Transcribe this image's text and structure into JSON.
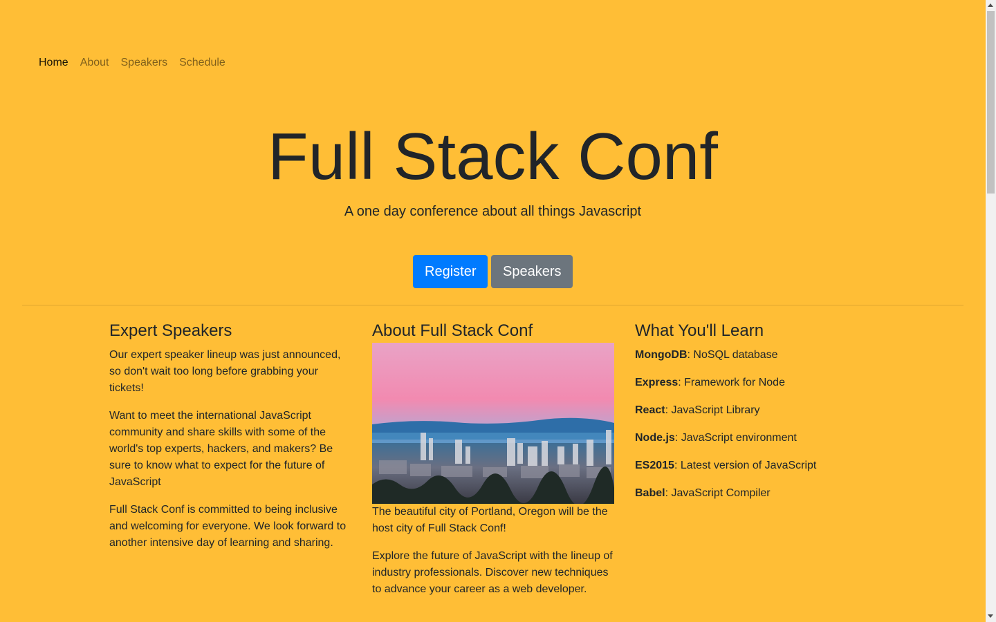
{
  "nav": {
    "items": [
      {
        "label": "Home",
        "active": true
      },
      {
        "label": "About",
        "active": false
      },
      {
        "label": "Speakers",
        "active": false
      },
      {
        "label": "Schedule",
        "active": false
      }
    ]
  },
  "hero": {
    "title": "Full Stack Conf",
    "subtitle": "A one day conference about all things Javascript",
    "register_label": "Register",
    "speakers_label": "Speakers"
  },
  "speakers_col": {
    "heading": "Expert Speakers",
    "paragraphs": [
      "Our expert speaker lineup was just announced, so don't wait too long before grabbing your tickets!",
      "Want to meet the international JavaScript community and share skills with some of the world's top experts, hackers, and makers? Be sure to know what to expect for the future of JavaScript",
      "Full Stack Conf is committed to being inclusive and welcoming for everyone. We look forward to another intensive day of learning and sharing."
    ]
  },
  "about_col": {
    "heading": "About Full Stack Conf",
    "image_alt": "Portland, Oregon skyline at dusk with Mount Hood",
    "paragraphs": [
      "The beautiful city of Portland, Oregon will be the host city of Full Stack Conf!",
      "Explore the future of JavaScript with the lineup of industry professionals. Discover new techniques to advance your career as a web developer."
    ]
  },
  "learn_col": {
    "heading": "What You'll Learn",
    "items": [
      {
        "term": "MongoDB",
        "desc": ": NoSQL database"
      },
      {
        "term": "Express",
        "desc": ": Framework for Node"
      },
      {
        "term": "React",
        "desc": ": JavaScript Library"
      },
      {
        "term": "Node.js",
        "desc": ": JavaScript environment"
      },
      {
        "term": "ES2015",
        "desc": ": Latest version of JavaScript"
      },
      {
        "term": "Babel",
        "desc": ": JavaScript Compiler"
      }
    ]
  },
  "colors": {
    "background": "#ffbe36",
    "primary": "#007bff",
    "secondary": "#6c757d",
    "text": "#212529"
  }
}
